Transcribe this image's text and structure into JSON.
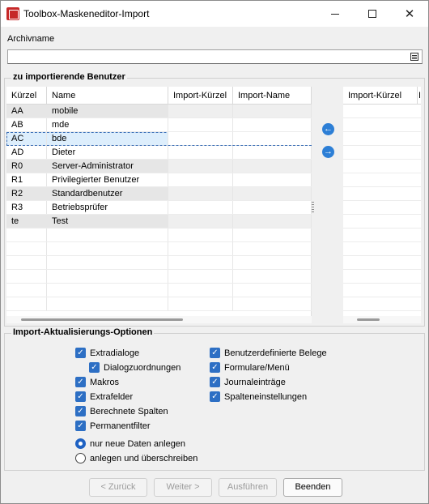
{
  "window": {
    "title": "Toolbox-Maskeneditor-Import"
  },
  "archiv": {
    "label": "Archivname",
    "value": ""
  },
  "users_group": {
    "title": "zu importierende Benutzer",
    "headers": [
      "Kürzel",
      "Name",
      "Import-Kürzel",
      "Import-Name"
    ],
    "rows": [
      {
        "kuerzel": "AA",
        "name": "mobile"
      },
      {
        "kuerzel": "AB",
        "name": "mde"
      },
      {
        "kuerzel": "AC",
        "name": "bde"
      },
      {
        "kuerzel": "AD",
        "name": "Dieter"
      },
      {
        "kuerzel": "R0",
        "name": "Server-Administrator"
      },
      {
        "kuerzel": "R1",
        "name": "Privilegierter Benutzer"
      },
      {
        "kuerzel": "R2",
        "name": "Standardbenutzer"
      },
      {
        "kuerzel": "R3",
        "name": "Betriebsprüfer"
      },
      {
        "kuerzel": "te",
        "name": "Test"
      }
    ],
    "selected_row": 2,
    "right_headers": [
      "Import-Kürzel",
      "I"
    ]
  },
  "options_group": {
    "title": "Import-Aktualisierungs-Optionen",
    "left": [
      {
        "label": "Extradialoge",
        "checked": true
      },
      {
        "label": "Dialogzuordnungen",
        "checked": true,
        "indent": true
      },
      {
        "label": "Makros",
        "checked": true
      },
      {
        "label": "Extrafelder",
        "checked": true
      },
      {
        "label": "Berechnete Spalten",
        "checked": true
      },
      {
        "label": "Permanentfilter",
        "checked": true
      }
    ],
    "right": [
      {
        "label": "Benutzerdefinierte Belege",
        "checked": true
      },
      {
        "label": "Formulare/Menü",
        "checked": true
      },
      {
        "label": "Journaleinträge",
        "checked": true
      },
      {
        "label": "Spalteneinstellungen",
        "checked": true
      }
    ],
    "radios": [
      {
        "label": "nur neue Daten anlegen",
        "selected": true
      },
      {
        "label": "anlegen und überschreiben",
        "selected": false
      }
    ]
  },
  "buttons": {
    "back": "< Zurück",
    "next": "Weiter >",
    "run": "Ausführen",
    "finish": "Beenden"
  },
  "colors": {
    "accent": "#2d6fc4",
    "selection": "#ddeefc"
  }
}
